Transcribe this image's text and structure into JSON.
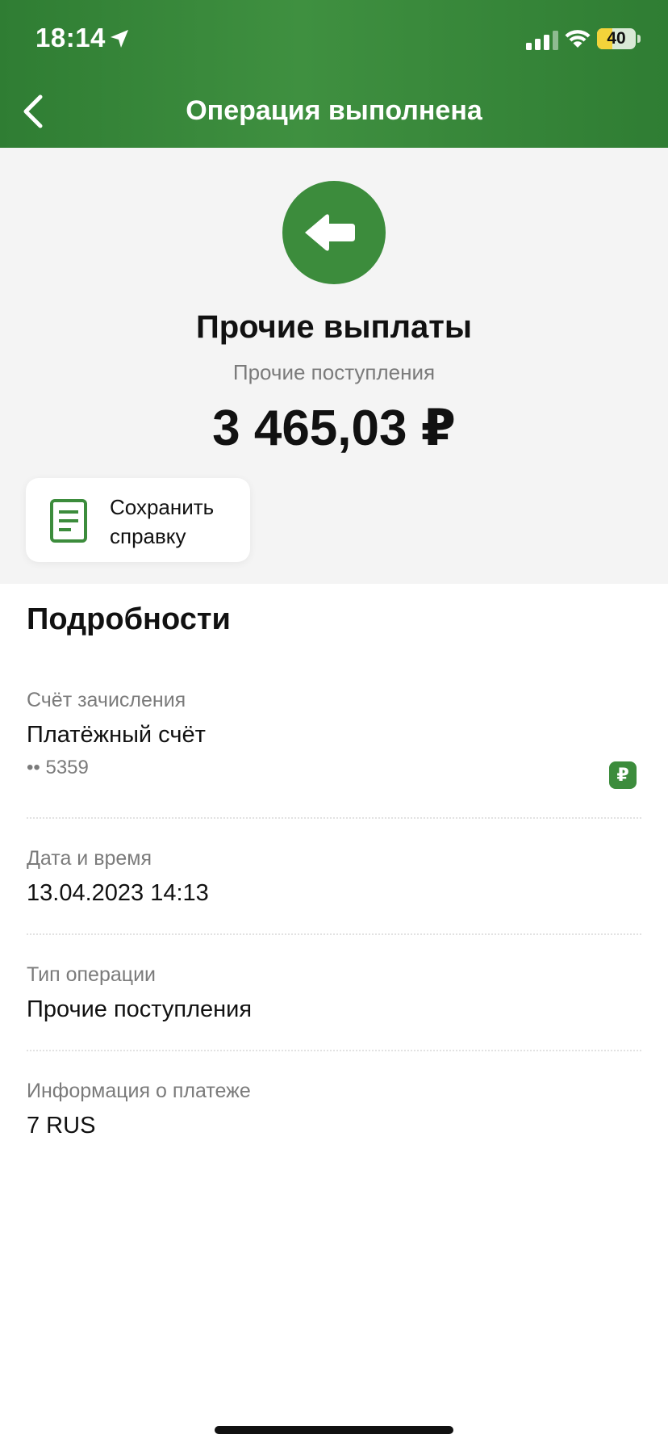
{
  "status_bar": {
    "time": "18:14",
    "battery": "40",
    "battery_level": 0.4
  },
  "header": {
    "title": "Операция выполнена"
  },
  "summary": {
    "name": "Прочие выплаты",
    "subtitle": "Прочие поступления",
    "amount": "3 465,03 ₽",
    "save_button_label": "Сохранить справку"
  },
  "details": {
    "title": "Подробности",
    "account_label": "Счёт зачисления",
    "account_value": "Платёжный счёт",
    "account_number": "•• 5359",
    "currency_badge": "₽",
    "datetime_label": "Дата и время",
    "datetime_value": "13.04.2023 14:13",
    "optype_label": "Тип операции",
    "optype_value": "Прочие поступления",
    "info_label": "Информация о платеже",
    "info_value": "7 RUS"
  },
  "colors": {
    "brand_green": "#3c8c3c",
    "header_green": "#3a8a3c",
    "muted_text": "#7b7b7b",
    "battery_yellow": "#f3d33a"
  },
  "icons": {
    "location": "location-arrow-icon",
    "signal": "cellular-signal-icon",
    "wifi": "wifi-icon",
    "back": "chevron-left-icon",
    "operation": "arrow-left-icon",
    "document": "document-icon"
  }
}
